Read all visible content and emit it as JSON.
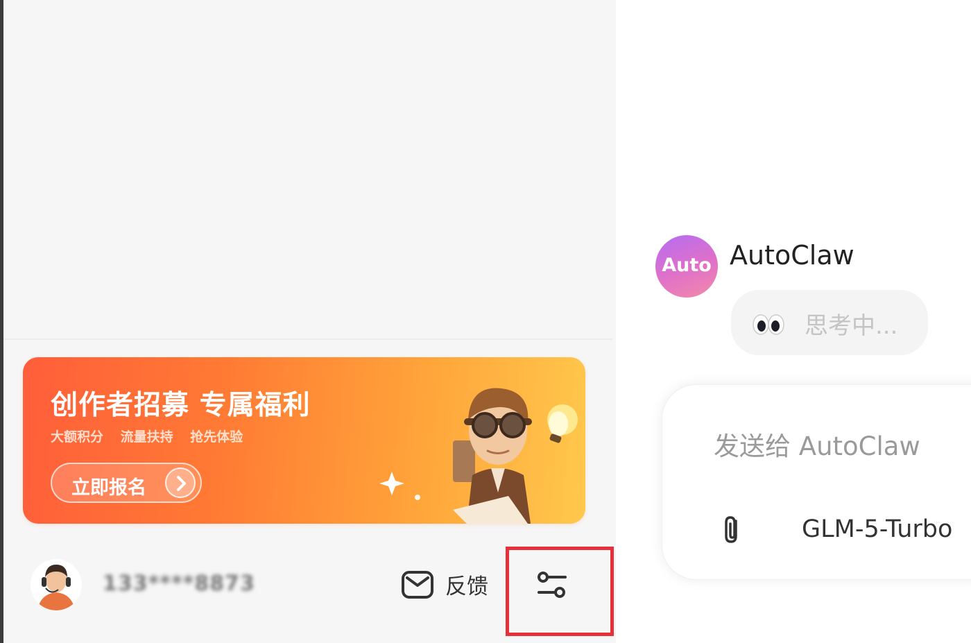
{
  "promo": {
    "title": "创作者招募 专属福利",
    "subtitles": [
      "大额积分",
      "流量扶持",
      "抢先体验"
    ],
    "button_label": "立即报名"
  },
  "user": {
    "name": "133****8873"
  },
  "footer": {
    "feedback_label": "反馈",
    "settings_icon": "sliders-icon",
    "highlight_color": "#e8303a"
  },
  "chat": {
    "agent_avatar_label": "Auto",
    "agent_name": "AutoClaw",
    "status_text": "思考中...",
    "composer_placeholder": "发送给 AutoClaw",
    "attach_icon": "paperclip-icon",
    "model_name": "GLM-5-Turbo"
  },
  "colors": {
    "promo_gradient_start": "#ff5e3a",
    "promo_gradient_end": "#ffc84c",
    "agent_avatar_start": "#b56cf2",
    "agent_avatar_end": "#f38aa8"
  }
}
